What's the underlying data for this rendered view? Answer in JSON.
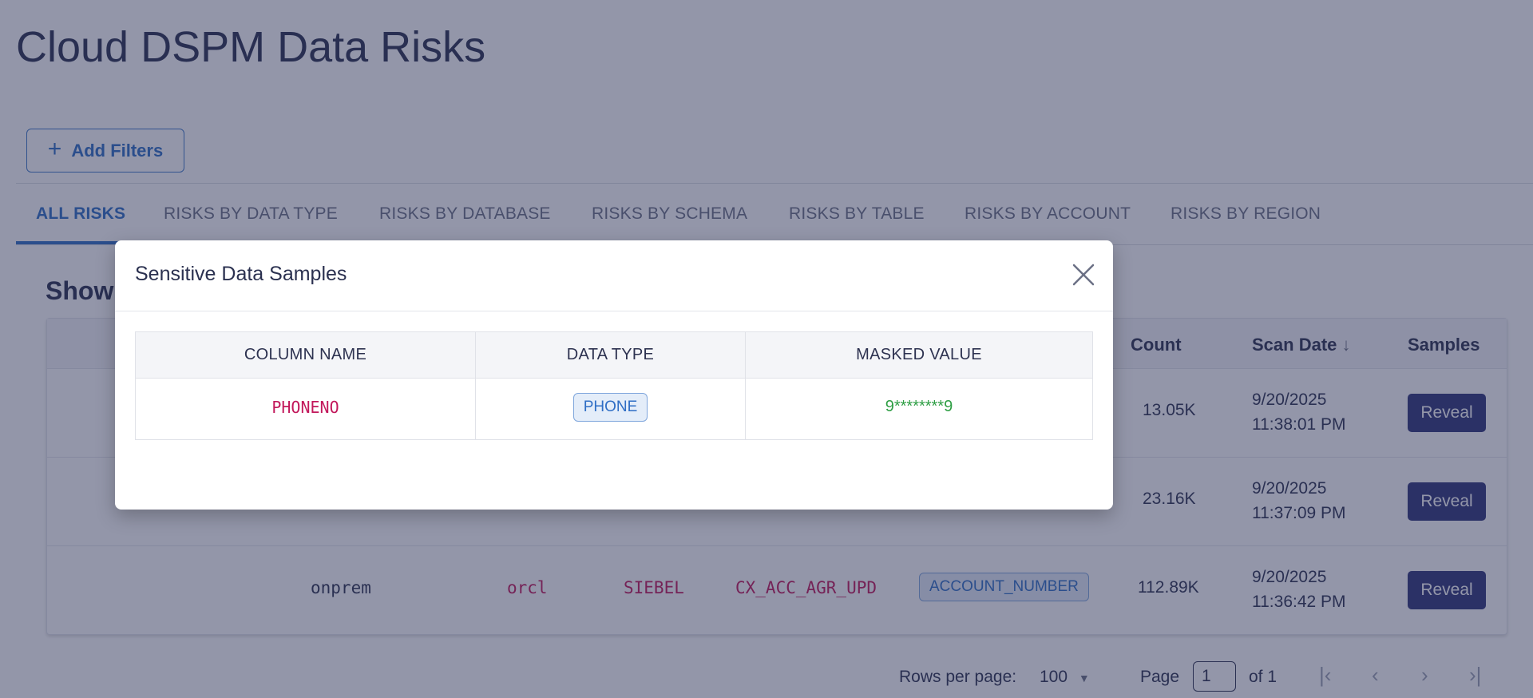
{
  "page": {
    "title": "Cloud DSPM Data Risks",
    "add_filters_label": "Add Filters",
    "showing_text": "Showi"
  },
  "tabs": [
    {
      "label": "ALL RISKS",
      "active": true
    },
    {
      "label": "RISKS BY DATA TYPE"
    },
    {
      "label": "RISKS BY DATABASE"
    },
    {
      "label": "RISKS BY SCHEMA"
    },
    {
      "label": "RISKS BY TABLE"
    },
    {
      "label": "RISKS BY ACCOUNT"
    },
    {
      "label": "RISKS BY REGION"
    }
  ],
  "table": {
    "headers": {
      "count": "Count",
      "scan_date": "Scan Date",
      "samples": "Samples"
    },
    "rows": [
      {
        "count": "13.05K",
        "date": "9/20/2025",
        "time": "11:38:01 PM",
        "action": "Reveal"
      },
      {
        "count": "23.16K",
        "date": "9/20/2025",
        "time": "11:37:09 PM",
        "action": "Reveal"
      },
      {
        "source": "onprem",
        "database": "orcl",
        "schema": "SIEBEL",
        "table": "CX_ACC_AGR_UPD",
        "data_type": "ACCOUNT_NUMBER",
        "count": "112.89K",
        "date": "9/20/2025",
        "time": "11:36:42 PM",
        "action": "Reveal"
      }
    ]
  },
  "pagination": {
    "rows_per_page_label": "Rows per page:",
    "rows_per_page_value": "100",
    "page_label": "Page",
    "page_value": "1",
    "of_label": "of 1"
  },
  "modal": {
    "title": "Sensitive Data Samples",
    "headers": [
      "COLUMN NAME",
      "DATA TYPE",
      "MASKED VALUE"
    ],
    "row": {
      "column_name": "PHONENO",
      "data_type": "PHONE",
      "masked_value": "9********9"
    }
  },
  "colors": {
    "accent": "#2f6ec5",
    "reveal_button": "#2f3478",
    "code_pink": "#c2185b",
    "masked_green": "#2e9e44"
  },
  "icons": [
    "plus-icon",
    "sort-down-arrow-icon",
    "dropdown-caret-icon",
    "first-page-icon",
    "prev-page-icon",
    "next-page-icon",
    "last-page-icon",
    "close-icon"
  ]
}
